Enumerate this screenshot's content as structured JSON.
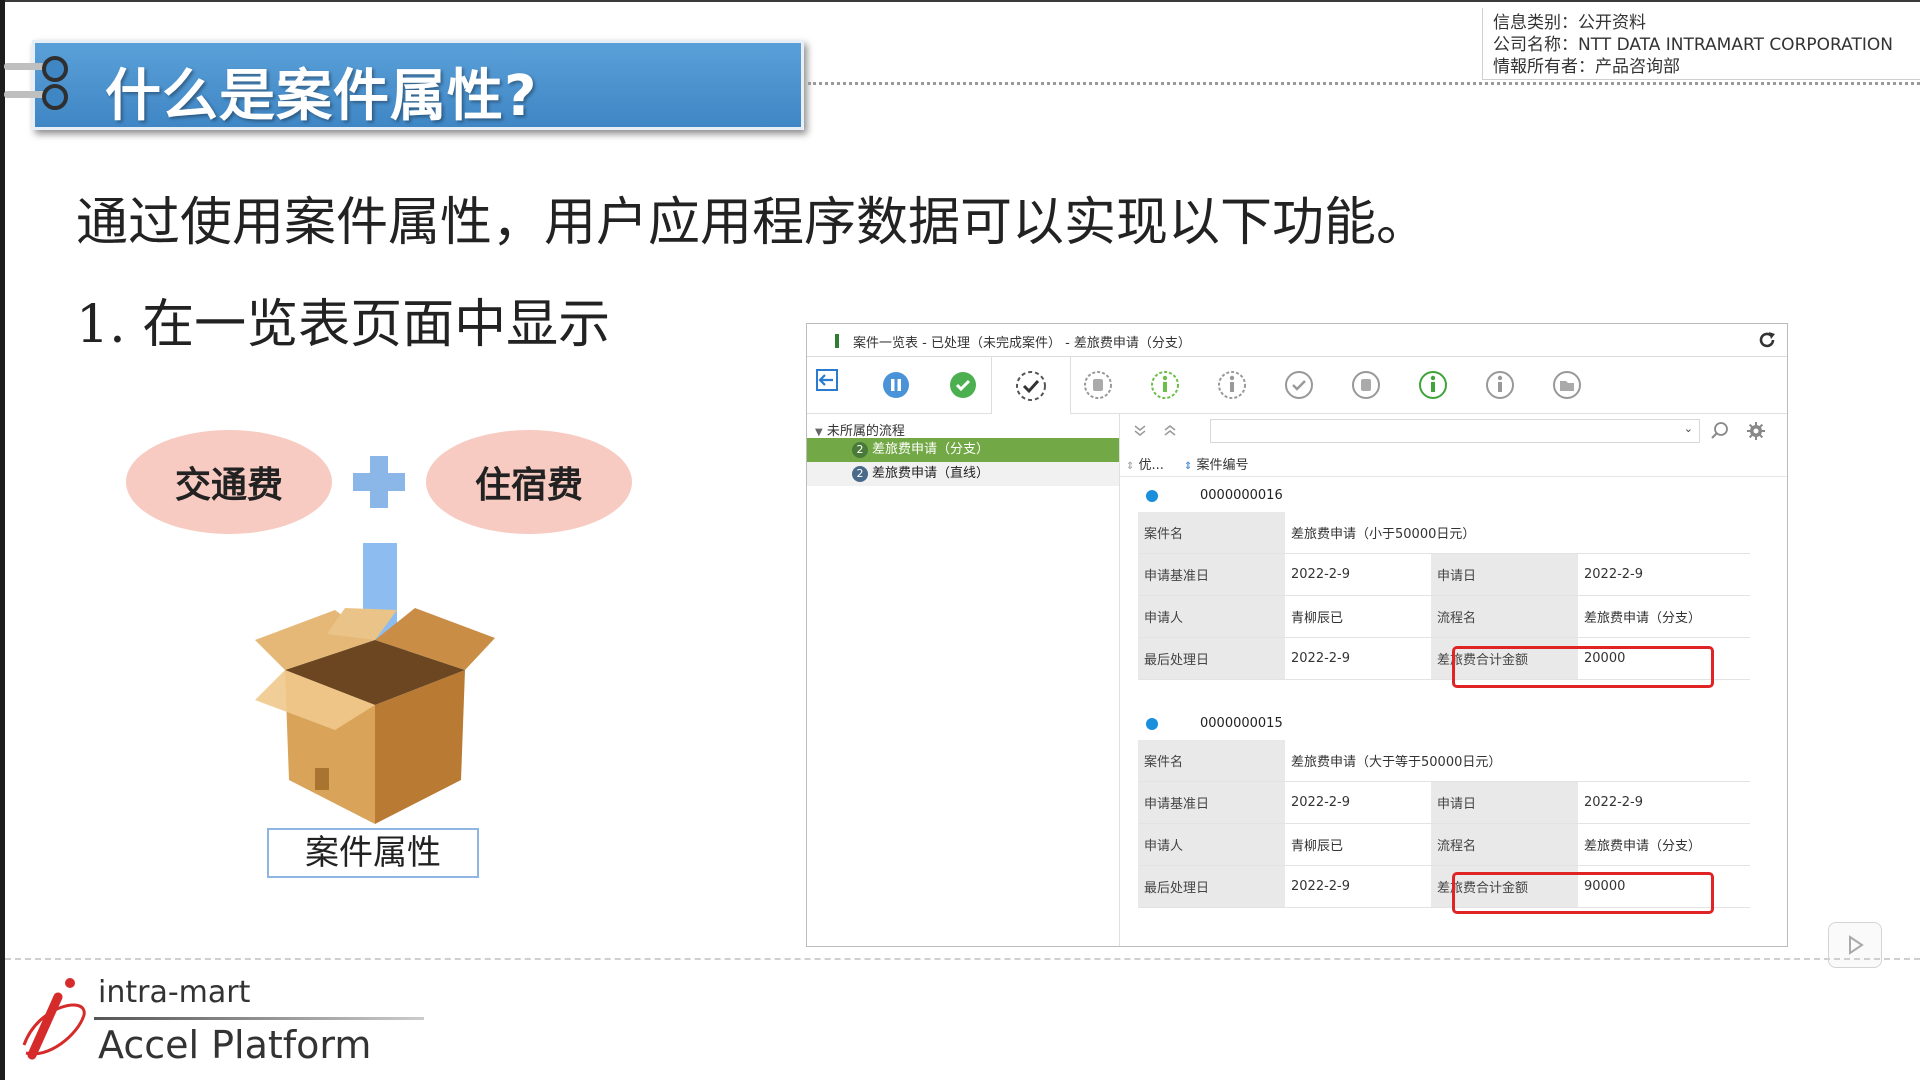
{
  "banner": {
    "title": "什么是案件属性?"
  },
  "info": {
    "line1": "信息类别：公开资料",
    "line2": "公司名称：NTT DATA INTRAMART CORPORATION",
    "line3": "情報所有者：产品咨询部"
  },
  "body": {
    "main": "通过使用案件属性，用户应用程序数据可以实现以下功能。",
    "item1": "1.  在一览表页面中显示"
  },
  "diagram": {
    "left_label": "交通费",
    "right_label": "住宿费",
    "box_label": "案件属性",
    "colors": {
      "ellipse": "#f7cbc1",
      "plus": "#8ab6e8",
      "arrow": "#8dbdf0"
    }
  },
  "panel": {
    "title": "案件一览表 - 已处理（未完成案件） - 差旅费申请（分支）",
    "tree_header": "未所属的流程",
    "tree_items": [
      {
        "badge": "2",
        "label": "差旅费申请（分支）"
      },
      {
        "badge": "2",
        "label": "差旅费申请（直线）"
      }
    ],
    "sort_priority": "优...",
    "sort_number": "案件编号",
    "records": [
      {
        "number": "0000000016",
        "name_label": "案件名",
        "name_value": "差旅费申请（小于50000日元）",
        "base_date_label": "申请基准日",
        "base_date_value": "2022-2-9",
        "apply_date_label": "申请日",
        "apply_date_value": "2022-2-9",
        "applicant_label": "申请人",
        "applicant_value": "青柳辰已",
        "flow_label": "流程名",
        "flow_value": "差旅费申请（分支）",
        "last_date_label": "最后处理日",
        "last_date_value": "2022-2-9",
        "amount_label": "差旅费合计金额",
        "amount_value": "20000"
      },
      {
        "number": "0000000015",
        "name_label": "案件名",
        "name_value": "差旅费申请（大于等于50000日元）",
        "base_date_label": "申请基准日",
        "base_date_value": "2022-2-9",
        "apply_date_label": "申请日",
        "apply_date_value": "2022-2-9",
        "applicant_label": "申请人",
        "applicant_value": "青柳辰已",
        "flow_label": "流程名",
        "flow_value": "差旅费申请（分支）",
        "last_date_label": "最后处理日",
        "last_date_value": "2022-2-9",
        "amount_label": "差旅费合计金额",
        "amount_value": "90000"
      }
    ]
  },
  "logo": {
    "top": "intra-mart",
    "bottom": "Accel Platform"
  },
  "colors": {
    "banner": "#4a90d0",
    "highlight": "#e02424",
    "tree_active": "#72a845"
  }
}
